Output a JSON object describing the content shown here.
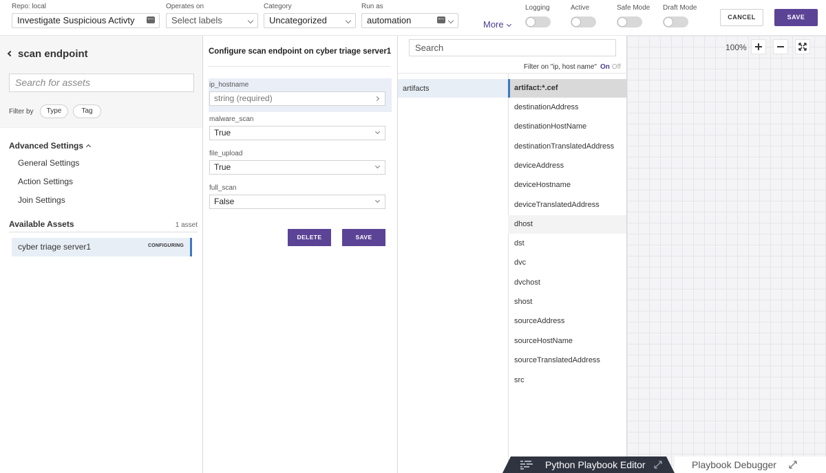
{
  "topbar": {
    "repo_label": "Repo: local",
    "name_value": "Investigate Suspicious Activty",
    "operates_label": "Operates on",
    "operates_placeholder": "Select labels",
    "category_label": "Category",
    "category_value": "Uncategorized",
    "runas_label": "Run as",
    "runas_value": "automation",
    "more_label": "More",
    "toggles": [
      "Logging",
      "Active",
      "Safe Mode",
      "Draft Mode"
    ],
    "cancel_label": "CANCEL",
    "save_label": "SAVE"
  },
  "left": {
    "back_title": "scan endpoint",
    "search_placeholder": "Search for assets",
    "filter_by": "Filter by",
    "filter_type": "Type",
    "filter_tag": "Tag",
    "advanced_settings": "Advanced Settings",
    "settings_items": [
      "General Settings",
      "Action Settings",
      "Join Settings"
    ],
    "available_assets": "Available Assets",
    "asset_count": "1 asset",
    "asset_name": "cyber triage server1",
    "asset_status": "CONFIGURING"
  },
  "config": {
    "title": "Configure scan endpoint on cyber triage server1",
    "params": [
      {
        "label": "ip_hostname",
        "value": "string (required)"
      },
      {
        "label": "malware_scan",
        "value": "True"
      },
      {
        "label": "file_upload",
        "value": "True"
      },
      {
        "label": "full_scan",
        "value": "False"
      }
    ],
    "delete_label": "DELETE",
    "save_label": "SAVE"
  },
  "datapanel": {
    "search_placeholder": "Search",
    "filter_text": "Filter on \"ip, host name\"",
    "filter_on": "On",
    "filter_off": "Off",
    "category": "artifacts",
    "fields": [
      "artifact:*.cef",
      "destinationAddress",
      "destinationHostName",
      "destinationTranslatedAddress",
      "deviceAddress",
      "deviceHostname",
      "deviceTranslatedAddress",
      "dhost",
      "dst",
      "dvc",
      "dvchost",
      "shost",
      "sourceAddress",
      "sourceHostName",
      "sourceTranslatedAddress",
      "src"
    ]
  },
  "canvas": {
    "zoom_level": "100%"
  },
  "bottom_tabs": {
    "python_editor": "Python Playbook Editor",
    "debugger": "Playbook Debugger"
  },
  "colors": {
    "primary": "#5b4396",
    "selection": "#3a79c2",
    "dark_tab": "#2f3440"
  }
}
